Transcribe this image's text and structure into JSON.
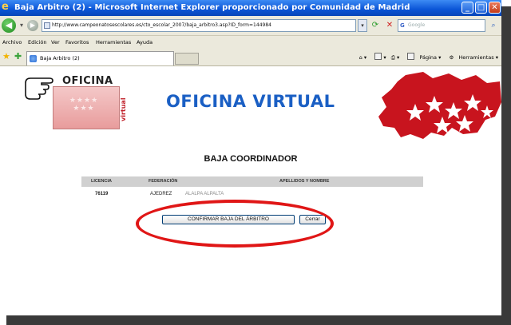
{
  "window": {
    "title": "Baja Arbitro (2) - Microsoft Internet Explorer proporcionado por Comunidad de Madrid",
    "minimize": "_",
    "maximize": "□",
    "close": "✕"
  },
  "address_bar": {
    "url": "http://www.campeonatosescolares.es/cto_escolar_2007/baja_arbitro3.asp?ID_form=144984",
    "search_placeholder": "Google"
  },
  "menu": [
    "Archivo",
    "Edición",
    "Ver",
    "Favoritos",
    "Herramientas",
    "Ayuda"
  ],
  "tab": {
    "label": "Baja Arbitro (2)"
  },
  "right_tools": {
    "page_label": "Página",
    "tools_label": "Herramientas"
  },
  "page": {
    "logo_text": "OFICINA",
    "logo_vertical": "virtual",
    "title": "OFICINA VIRTUAL",
    "section_title": "BAJA COORDINADOR",
    "table": {
      "headers": [
        "LICENCIA",
        "FEDERACIÓN",
        "APELLIDOS Y NOMBRE"
      ],
      "rows": [
        [
          "76119",
          "AJEDREZ",
          "ALALPA ALPALTA"
        ]
      ]
    },
    "buttons": {
      "confirm": "CONFIRMAR BAJA DEL ÁRBITRO",
      "close": "Cerrar"
    }
  },
  "colors": {
    "title_blue": "#1a5fc4",
    "highlight_red": "#e01616",
    "xp_blue": "#0a54d6"
  },
  "icons": [
    "ie-icon",
    "back-icon",
    "forward-icon",
    "refresh-icon",
    "stop-icon",
    "search-go-icon",
    "favorites-star-icon",
    "add-favorite-icon",
    "home-icon",
    "feeds-icon",
    "print-icon",
    "page-icon",
    "tools-icon",
    "pointing-hand-icon",
    "madrid-map-icon"
  ]
}
